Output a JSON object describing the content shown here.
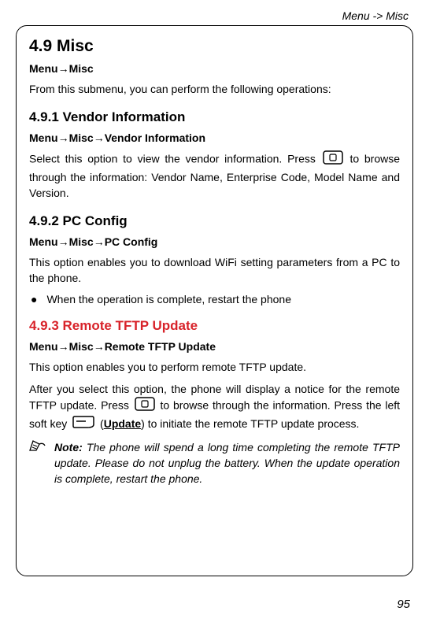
{
  "header": {
    "breadcrumb": "Menu -> Misc"
  },
  "section_main": {
    "title": "4.9 Misc",
    "breadcrumb_parts": [
      "Menu",
      "Misc"
    ],
    "intro": "From this submenu, you can perform the following operations:"
  },
  "section_vendor": {
    "title": "4.9.1 Vendor Information",
    "breadcrumb_parts": [
      "Menu",
      "Misc",
      "Vendor Information"
    ],
    "para_before": "Select this option to view the vendor information. Press",
    "para_after": "to browse through the information: Vendor Name, Enterprise Code, Model Name and Version."
  },
  "section_pc": {
    "title": "4.9.2 PC Config",
    "breadcrumb_parts": [
      "Menu",
      "Misc",
      "PC Config"
    ],
    "para": "This option enables you to download WiFi setting parameters from a PC to the phone.",
    "bullet": "When the operation is complete, restart the phone"
  },
  "section_tftp": {
    "title": "4.9.3 Remote TFTP Update",
    "breadcrumb_parts": [
      "Menu",
      "Misc",
      "Remote TFTP Update"
    ],
    "para1": "This option enables you to perform remote TFTP update.",
    "para2_a": "After you select this option, the phone will display a notice for the remote TFTP update. Press",
    "para2_b": "to browse through the information. Press the left soft key",
    "para2_c_open": "(",
    "para2_c_word": "Update",
    "para2_c_close": ") to initiate the remote TFTP update process.",
    "note_label": "Note:",
    "note_body": "The phone will spend a long time completing the remote TFTP update. Please do not unplug the battery. When the update operation is complete, restart the phone."
  },
  "arrow_glyph": "→",
  "bullet_glyph": "●",
  "pagenum": "95"
}
